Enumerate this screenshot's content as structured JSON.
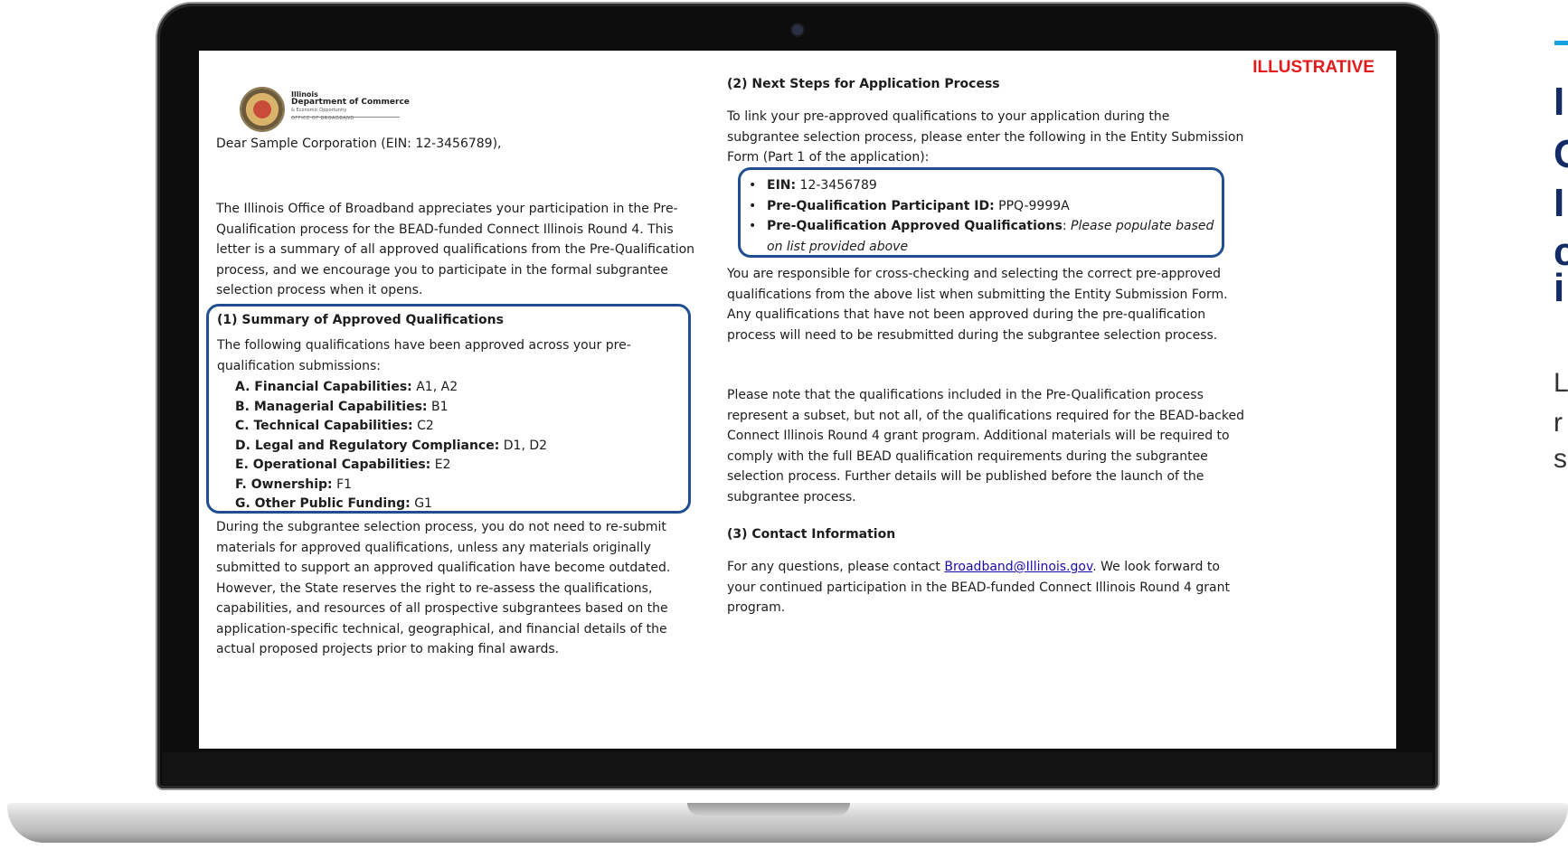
{
  "watermark": "ILLUSTRATIVE",
  "logo": {
    "line1": "Illinois",
    "line2": "Department of Commerce",
    "line3": "& Economic Opportunity",
    "line4": "OFFICE OF BROADBAND"
  },
  "greeting": "Dear Sample Corporation (EIN: 12-3456789),",
  "intro": "The Illinois Office of Broadband appreciates your participation in the Pre-Qualification process for the BEAD-funded Connect Illinois Round 4. This letter is a summary of all approved qualifications from the Pre-Qualification process, and we encourage you to participate in the formal subgrantee selection process when it opens.",
  "section1": {
    "heading": "(1) Summary of Approved Qualifications",
    "lead": "The following qualifications have been approved across your pre-qualification submissions:",
    "items": [
      {
        "label": "A.  Financial Capabilities:",
        "value": " A1, A2"
      },
      {
        "label": "B.  Managerial Capabilities:",
        "value": " B1"
      },
      {
        "label": "C.  Technical Capabilities:",
        "value": " C2"
      },
      {
        "label": "D.  Legal and Regulatory Compliance:",
        "value": " D1, D2"
      },
      {
        "label": "E.  Operational Capabilities:",
        "value": " E2"
      },
      {
        "label": "F.  Ownership:",
        "value": " F1"
      },
      {
        "label": "G.  Other Public Funding:",
        "value": " G1"
      }
    ],
    "followup": "During the subgrantee selection process, you do not need to re-submit materials for approved qualifications, unless any materials originally submitted to support an approved qualification have become outdated. However, the State reserves the right to re-assess the qualifications, capabilities, and resources of all prospective subgrantees based on the application-specific technical, geographical, and financial details of the actual proposed projects prior to making final awards."
  },
  "section2": {
    "heading": "(2) Next Steps for Application Process",
    "lead": "To link your pre-approved qualifications to your application during the subgrantee selection process, please enter the following in the Entity Submission Form (Part 1 of the application):",
    "bullets": [
      {
        "label": "EIN:",
        "value": " 12-3456789",
        "italic": ""
      },
      {
        "label": "Pre-Qualification Participant ID:",
        "value": " PPQ-9999A",
        "italic": ""
      },
      {
        "label": "Pre-Qualification Approved Qualifications",
        "value": ": ",
        "italic": "Please populate based on list provided above"
      }
    ],
    "responsibility": "You are responsible for cross-checking and selecting the correct pre-approved qualifications from the above list when submitting the Entity Submission Form. Any qualifications that have not been approved during the pre-qualification process will need to be resubmitted during the subgrantee selection process.",
    "note": "Please note that the qualifications included in the Pre-Qualification process represent a subset, but not all, of the qualifications required for the BEAD-backed Connect Illinois Round 4 grant program. Additional materials will be required to comply with the full BEAD qualification requirements during the subgrantee selection process. Further details will be published before the launch of the subgrantee process."
  },
  "section3": {
    "heading": "(3) Contact Information",
    "text_before": "For any questions, please contact ",
    "email": "Broadband@Illinois.gov",
    "text_after": ". We look forward to your continued participation in the BEAD-funded Connect Illinois Round 4 grant program."
  },
  "side_panel": {
    "big_lines": [
      "I",
      "C",
      "I",
      "c",
      "i"
    ],
    "small_lines": [
      "L",
      "r",
      "s"
    ]
  },
  "colors": {
    "box_border": "#1f4e91",
    "watermark": "#e31b1b",
    "side_heading": "#142c66",
    "side_accent": "#1aa0e0"
  }
}
